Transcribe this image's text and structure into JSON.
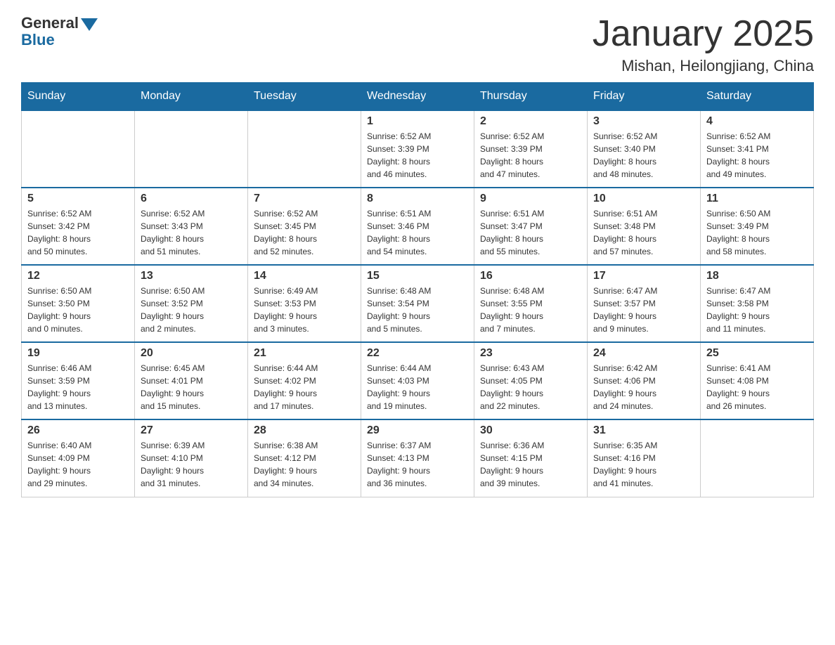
{
  "header": {
    "logo_general": "General",
    "logo_blue": "Blue",
    "month_title": "January 2025",
    "location": "Mishan, Heilongjiang, China"
  },
  "days_of_week": [
    "Sunday",
    "Monday",
    "Tuesday",
    "Wednesday",
    "Thursday",
    "Friday",
    "Saturday"
  ],
  "weeks": [
    [
      {
        "day": "",
        "info": ""
      },
      {
        "day": "",
        "info": ""
      },
      {
        "day": "",
        "info": ""
      },
      {
        "day": "1",
        "info": "Sunrise: 6:52 AM\nSunset: 3:39 PM\nDaylight: 8 hours\nand 46 minutes."
      },
      {
        "day": "2",
        "info": "Sunrise: 6:52 AM\nSunset: 3:39 PM\nDaylight: 8 hours\nand 47 minutes."
      },
      {
        "day": "3",
        "info": "Sunrise: 6:52 AM\nSunset: 3:40 PM\nDaylight: 8 hours\nand 48 minutes."
      },
      {
        "day": "4",
        "info": "Sunrise: 6:52 AM\nSunset: 3:41 PM\nDaylight: 8 hours\nand 49 minutes."
      }
    ],
    [
      {
        "day": "5",
        "info": "Sunrise: 6:52 AM\nSunset: 3:42 PM\nDaylight: 8 hours\nand 50 minutes."
      },
      {
        "day": "6",
        "info": "Sunrise: 6:52 AM\nSunset: 3:43 PM\nDaylight: 8 hours\nand 51 minutes."
      },
      {
        "day": "7",
        "info": "Sunrise: 6:52 AM\nSunset: 3:45 PM\nDaylight: 8 hours\nand 52 minutes."
      },
      {
        "day": "8",
        "info": "Sunrise: 6:51 AM\nSunset: 3:46 PM\nDaylight: 8 hours\nand 54 minutes."
      },
      {
        "day": "9",
        "info": "Sunrise: 6:51 AM\nSunset: 3:47 PM\nDaylight: 8 hours\nand 55 minutes."
      },
      {
        "day": "10",
        "info": "Sunrise: 6:51 AM\nSunset: 3:48 PM\nDaylight: 8 hours\nand 57 minutes."
      },
      {
        "day": "11",
        "info": "Sunrise: 6:50 AM\nSunset: 3:49 PM\nDaylight: 8 hours\nand 58 minutes."
      }
    ],
    [
      {
        "day": "12",
        "info": "Sunrise: 6:50 AM\nSunset: 3:50 PM\nDaylight: 9 hours\nand 0 minutes."
      },
      {
        "day": "13",
        "info": "Sunrise: 6:50 AM\nSunset: 3:52 PM\nDaylight: 9 hours\nand 2 minutes."
      },
      {
        "day": "14",
        "info": "Sunrise: 6:49 AM\nSunset: 3:53 PM\nDaylight: 9 hours\nand 3 minutes."
      },
      {
        "day": "15",
        "info": "Sunrise: 6:48 AM\nSunset: 3:54 PM\nDaylight: 9 hours\nand 5 minutes."
      },
      {
        "day": "16",
        "info": "Sunrise: 6:48 AM\nSunset: 3:55 PM\nDaylight: 9 hours\nand 7 minutes."
      },
      {
        "day": "17",
        "info": "Sunrise: 6:47 AM\nSunset: 3:57 PM\nDaylight: 9 hours\nand 9 minutes."
      },
      {
        "day": "18",
        "info": "Sunrise: 6:47 AM\nSunset: 3:58 PM\nDaylight: 9 hours\nand 11 minutes."
      }
    ],
    [
      {
        "day": "19",
        "info": "Sunrise: 6:46 AM\nSunset: 3:59 PM\nDaylight: 9 hours\nand 13 minutes."
      },
      {
        "day": "20",
        "info": "Sunrise: 6:45 AM\nSunset: 4:01 PM\nDaylight: 9 hours\nand 15 minutes."
      },
      {
        "day": "21",
        "info": "Sunrise: 6:44 AM\nSunset: 4:02 PM\nDaylight: 9 hours\nand 17 minutes."
      },
      {
        "day": "22",
        "info": "Sunrise: 6:44 AM\nSunset: 4:03 PM\nDaylight: 9 hours\nand 19 minutes."
      },
      {
        "day": "23",
        "info": "Sunrise: 6:43 AM\nSunset: 4:05 PM\nDaylight: 9 hours\nand 22 minutes."
      },
      {
        "day": "24",
        "info": "Sunrise: 6:42 AM\nSunset: 4:06 PM\nDaylight: 9 hours\nand 24 minutes."
      },
      {
        "day": "25",
        "info": "Sunrise: 6:41 AM\nSunset: 4:08 PM\nDaylight: 9 hours\nand 26 minutes."
      }
    ],
    [
      {
        "day": "26",
        "info": "Sunrise: 6:40 AM\nSunset: 4:09 PM\nDaylight: 9 hours\nand 29 minutes."
      },
      {
        "day": "27",
        "info": "Sunrise: 6:39 AM\nSunset: 4:10 PM\nDaylight: 9 hours\nand 31 minutes."
      },
      {
        "day": "28",
        "info": "Sunrise: 6:38 AM\nSunset: 4:12 PM\nDaylight: 9 hours\nand 34 minutes."
      },
      {
        "day": "29",
        "info": "Sunrise: 6:37 AM\nSunset: 4:13 PM\nDaylight: 9 hours\nand 36 minutes."
      },
      {
        "day": "30",
        "info": "Sunrise: 6:36 AM\nSunset: 4:15 PM\nDaylight: 9 hours\nand 39 minutes."
      },
      {
        "day": "31",
        "info": "Sunrise: 6:35 AM\nSunset: 4:16 PM\nDaylight: 9 hours\nand 41 minutes."
      },
      {
        "day": "",
        "info": ""
      }
    ]
  ]
}
